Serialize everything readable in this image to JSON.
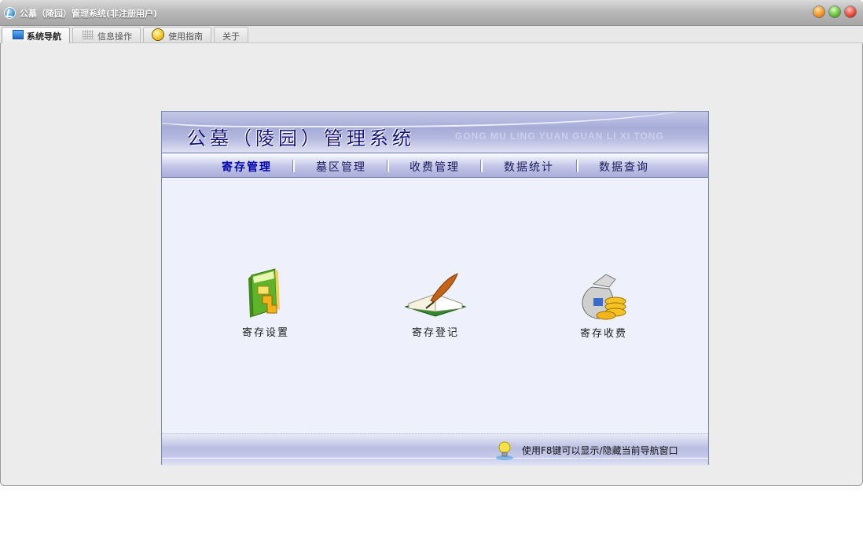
{
  "window": {
    "title": "公墓（陵园）管理系统(非注册用户)"
  },
  "tabs": [
    {
      "label": "系统导航",
      "icon": "monitor-icon",
      "active": true
    },
    {
      "label": "信息操作",
      "icon": "grid-icon",
      "active": false
    },
    {
      "label": "使用指南",
      "icon": "help-icon",
      "active": false
    },
    {
      "label": "关于",
      "icon": "",
      "active": false
    }
  ],
  "banner": {
    "title": "公墓（陵园）管理系统",
    "pinyin": "GONG MU LING YUAN GUAN LI XI TONG"
  },
  "menu": [
    {
      "label": "寄存管理",
      "active": true
    },
    {
      "label": "墓区管理",
      "active": false
    },
    {
      "label": "收费管理",
      "active": false
    },
    {
      "label": "数据统计",
      "active": false
    },
    {
      "label": "数据查询",
      "active": false
    }
  ],
  "features": [
    {
      "label": "寄存设置",
      "icon": "book-icon"
    },
    {
      "label": "寄存登记",
      "icon": "quill-book-icon"
    },
    {
      "label": "寄存收费",
      "icon": "money-bag-icon"
    }
  ],
  "footer": {
    "tip": "使用F8键可以显示/隐藏当前导航窗口",
    "icon": "lightbulb-icon"
  },
  "colors": {
    "banner_text": "#13137a",
    "active_menu": "#0000b0",
    "panel_bg": "#eef1fb"
  }
}
